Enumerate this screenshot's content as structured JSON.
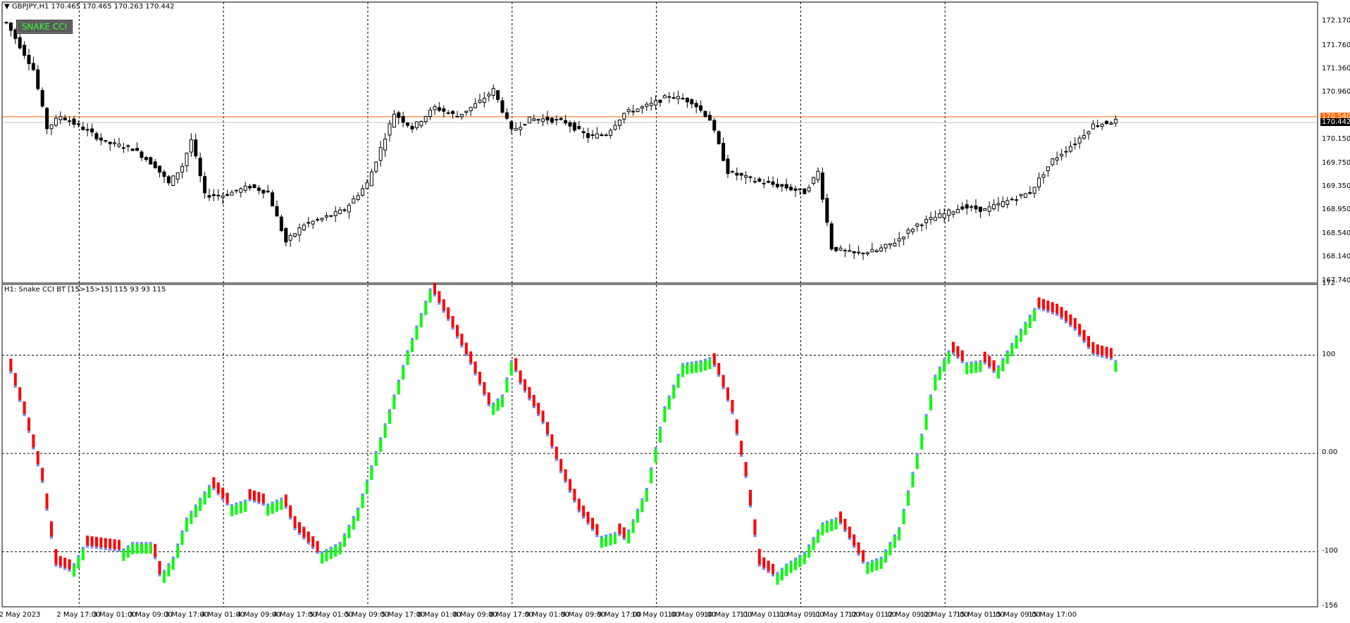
{
  "price_panel": {
    "header": "GBPJPY,H1  170.465 170.465 170.263 170.442",
    "button_label": "SNAKE CCI",
    "y_ticks": [
      "172.170",
      "171.760",
      "171.360",
      "170.960",
      "170.150",
      "169.750",
      "169.350",
      "168.950",
      "168.540",
      "168.140",
      "167.740"
    ],
    "bid_tag": "170.540",
    "last_tag": "170.442",
    "bid_level": 170.54,
    "last_level": 170.442,
    "ylim": [
      167.7,
      172.5
    ],
    "colors": {
      "bid_line": "#ff6600",
      "last_line": "#c0c0c0",
      "bull_fill": "#ffffff",
      "bear_fill": "#000000"
    }
  },
  "indicator_panel": {
    "header": "H1: Snake CCI BT [15>15>15]  115 93 93 115",
    "y_ticks": [
      "172",
      "100",
      "0.00",
      "-100",
      "-156"
    ],
    "ylim": [
      -156,
      172
    ],
    "colors": {
      "up": "#00ff00",
      "down": "#ff0000",
      "cap": "#6f8fff"
    }
  },
  "x_ticks": [
    "2 May 2023",
    "2 May 17:00",
    "3 May 01:00",
    "3 May 09:00",
    "3 May 17:00",
    "4 May 01:00",
    "4 May 09:00",
    "4 May 17:00",
    "5 May 01:00",
    "5 May 09:00",
    "5 May 17:00",
    "8 May 01:00",
    "8 May 09:00",
    "8 May 17:00",
    "9 May 01:00",
    "9 May 09:00",
    "9 May 17:00",
    "10 May 01:00",
    "10 May 09:00",
    "10 May 17:00",
    "11 May 01:00",
    "11 May 09:00",
    "11 May 17:00",
    "12 May 01:00",
    "12 May 09:00",
    "12 May 17:00",
    "15 May 01:00",
    "15 May 09:00",
    "15 May 17:00"
  ],
  "chart_data": {
    "type": "candlestick",
    "symbol": "GBPJPY",
    "timeframe": "H1",
    "price_keypoints": [
      [
        0,
        172.15
      ],
      [
        3,
        171.75
      ],
      [
        6,
        171.35
      ],
      [
        9,
        170.35
      ],
      [
        12,
        170.55
      ],
      [
        18,
        170.3
      ],
      [
        22,
        170.1
      ],
      [
        28,
        170.0
      ],
      [
        33,
        169.7
      ],
      [
        36,
        169.4
      ],
      [
        39,
        169.7
      ],
      [
        41,
        170.15
      ],
      [
        44,
        169.2
      ],
      [
        48,
        169.2
      ],
      [
        54,
        169.35
      ],
      [
        58,
        169.25
      ],
      [
        62,
        168.4
      ],
      [
        66,
        168.7
      ],
      [
        70,
        168.8
      ],
      [
        75,
        168.95
      ],
      [
        80,
        169.4
      ],
      [
        86,
        170.6
      ],
      [
        90,
        170.35
      ],
      [
        95,
        170.7
      ],
      [
        100,
        170.55
      ],
      [
        105,
        170.8
      ],
      [
        108,
        171.0
      ],
      [
        112,
        170.3
      ],
      [
        116,
        170.5
      ],
      [
        120,
        170.5
      ],
      [
        124,
        170.45
      ],
      [
        129,
        170.2
      ],
      [
        133,
        170.25
      ],
      [
        137,
        170.6
      ],
      [
        143,
        170.75
      ],
      [
        147,
        170.9
      ],
      [
        152,
        170.8
      ],
      [
        156,
        170.5
      ],
      [
        160,
        169.6
      ],
      [
        166,
        169.45
      ],
      [
        172,
        169.35
      ],
      [
        177,
        169.25
      ],
      [
        180,
        169.6
      ],
      [
        183,
        168.3
      ],
      [
        188,
        168.2
      ],
      [
        193,
        168.25
      ],
      [
        197,
        168.4
      ],
      [
        202,
        168.7
      ],
      [
        207,
        168.85
      ],
      [
        212,
        169.0
      ],
      [
        217,
        168.95
      ],
      [
        222,
        169.1
      ],
      [
        227,
        169.25
      ],
      [
        232,
        169.8
      ],
      [
        237,
        170.1
      ],
      [
        241,
        170.4
      ],
      [
        246,
        170.47
      ]
    ],
    "cci_keypoints": [
      [
        0,
        96
      ],
      [
        4,
        38
      ],
      [
        8,
        -30
      ],
      [
        11,
        -115
      ],
      [
        14,
        -120
      ],
      [
        17,
        -95
      ],
      [
        20,
        -97
      ],
      [
        25,
        -100
      ],
      [
        28,
        -90
      ],
      [
        32,
        -90
      ],
      [
        34,
        -125
      ],
      [
        37,
        -105
      ],
      [
        40,
        -65
      ],
      [
        45,
        -32
      ],
      [
        49,
        -53
      ],
      [
        53,
        -47
      ],
      [
        57,
        -53
      ],
      [
        61,
        -45
      ],
      [
        64,
        -78
      ],
      [
        69,
        -102
      ],
      [
        74,
        -90
      ],
      [
        78,
        -55
      ],
      [
        85,
        45
      ],
      [
        89,
        105
      ],
      [
        94,
        168
      ],
      [
        98,
        135
      ],
      [
        103,
        90
      ],
      [
        107,
        48
      ],
      [
        110,
        60
      ],
      [
        112,
        95
      ],
      [
        114,
        70
      ],
      [
        119,
        30
      ],
      [
        123,
        -20
      ],
      [
        127,
        -60
      ],
      [
        131,
        -85
      ],
      [
        135,
        -80
      ],
      [
        137,
        -88
      ],
      [
        142,
        -35
      ],
      [
        146,
        48
      ],
      [
        150,
        92
      ],
      [
        154,
        95
      ],
      [
        156,
        98
      ],
      [
        158,
        78
      ],
      [
        161,
        40
      ],
      [
        164,
        -25
      ],
      [
        167,
        -115
      ],
      [
        170,
        -125
      ],
      [
        173,
        -112
      ],
      [
        177,
        -100
      ],
      [
        181,
        -70
      ],
      [
        184,
        -65
      ],
      [
        186,
        -80
      ],
      [
        190,
        -112
      ],
      [
        194,
        -105
      ],
      [
        198,
        -75
      ],
      [
        202,
        0
      ],
      [
        206,
        80
      ],
      [
        209,
        105
      ],
      [
        212,
        92
      ],
      [
        216,
        95
      ],
      [
        219,
        82
      ],
      [
        224,
        120
      ],
      [
        228,
        148
      ],
      [
        233,
        140
      ],
      [
        237,
        125
      ],
      [
        241,
        100
      ],
      [
        245,
        95
      ]
    ]
  }
}
